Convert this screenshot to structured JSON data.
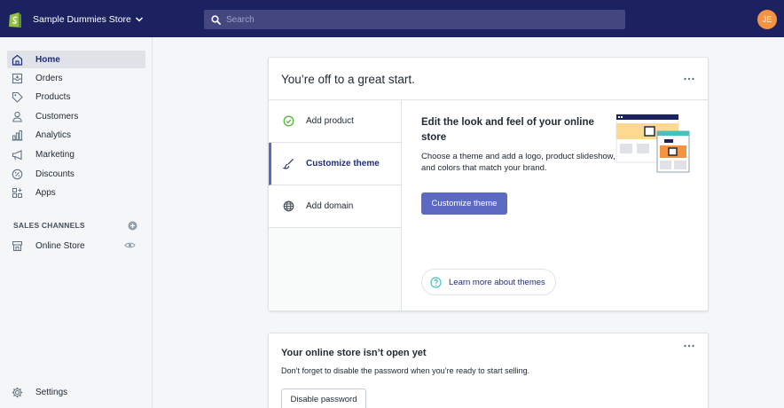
{
  "topbar": {
    "store_name": "Sample Dummies Store",
    "search_placeholder": "Search",
    "avatar_initials": "JE"
  },
  "sidebar": {
    "items": [
      {
        "label": "Home",
        "icon": "home-icon",
        "active": true
      },
      {
        "label": "Orders",
        "icon": "orders-icon"
      },
      {
        "label": "Products",
        "icon": "tag-icon"
      },
      {
        "label": "Customers",
        "icon": "person-icon"
      },
      {
        "label": "Analytics",
        "icon": "bar-chart-icon"
      },
      {
        "label": "Marketing",
        "icon": "megaphone-icon"
      },
      {
        "label": "Discounts",
        "icon": "discount-icon"
      },
      {
        "label": "Apps",
        "icon": "apps-icon"
      }
    ],
    "channels_title": "SALES CHANNELS",
    "online_store_label": "Online Store",
    "settings_label": "Settings"
  },
  "setup_card": {
    "title": "You’re off to a great start.",
    "tabs": [
      {
        "label": "Add product",
        "icon": "check-circle-icon"
      },
      {
        "label": "Customize theme",
        "icon": "paintbrush-icon",
        "active": true
      },
      {
        "label": "Add domain",
        "icon": "globe-icon"
      }
    ],
    "heading": "Edit the look and feel of your online store",
    "text": "Choose a theme and add a logo, product slideshow, and colors that match your brand.",
    "button_label": "Customize theme",
    "learn_more_label": "Learn more about themes"
  },
  "password_card": {
    "title": "Your online store isn’t open yet",
    "text": "Don’t forget to disable the password when you’re ready to start selling.",
    "button_label": "Disable password"
  },
  "colors": {
    "topbar": "#1c2260",
    "search": "#43467f",
    "accent": "#5c6ac4",
    "avatar": "#f49342",
    "active_text": "#202e78"
  }
}
